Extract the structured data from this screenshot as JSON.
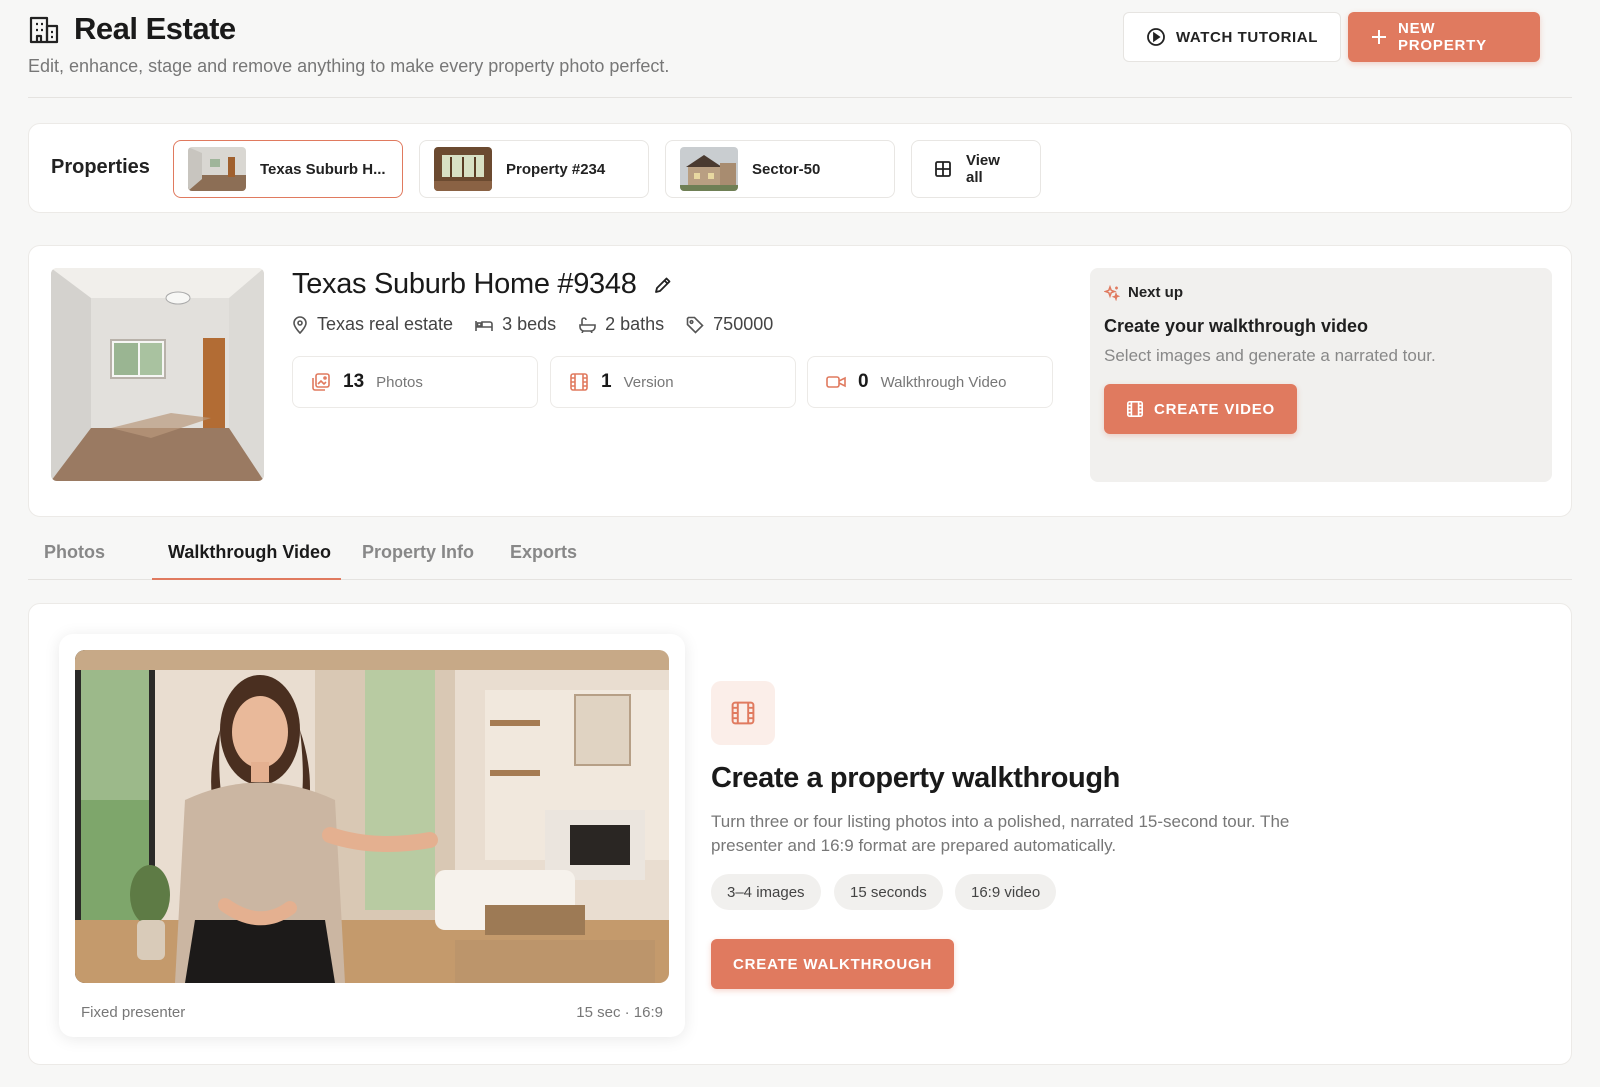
{
  "header": {
    "title": "Real Estate",
    "subtitle": "Edit, enhance, stage and remove anything to make every property photo perfect.",
    "watch_tutorial": "WATCH TUTORIAL",
    "new_property": "NEW PROPERTY"
  },
  "properties": {
    "label": "Properties",
    "items": [
      {
        "name": "Texas Suburb H..."
      },
      {
        "name": "Property #234"
      },
      {
        "name": "Sector-50"
      }
    ],
    "view_all": "View all"
  },
  "property": {
    "title": "Texas Suburb Home #9348",
    "location": "Texas real estate",
    "beds": "3 beds",
    "baths": "2 baths",
    "price": "750000",
    "stats": [
      {
        "value": "13",
        "label": "Photos"
      },
      {
        "value": "1",
        "label": "Version"
      },
      {
        "value": "0",
        "label": "Walkthrough Video"
      }
    ]
  },
  "next_up": {
    "tag": "Next up",
    "heading": "Create your walkthrough video",
    "text": "Select images and generate a narrated tour.",
    "button": "CREATE VIDEO"
  },
  "tabs": [
    "Photos",
    "Walkthrough Video",
    "Property Info",
    "Exports"
  ],
  "walkthrough": {
    "caption_left": "Fixed presenter",
    "caption_right": "15 sec · 16:9",
    "heading": "Create a property walkthrough",
    "description": "Turn three or four listing photos into a polished, narrated 15-second tour. The presenter and 16:9 format are prepared automatically.",
    "pills": [
      "3–4 images",
      "15 seconds",
      "16:9 video"
    ],
    "button": "CREATE WALKTHROUGH"
  },
  "colors": {
    "accent": "#e07a5f",
    "background": "#f7f7f6"
  }
}
